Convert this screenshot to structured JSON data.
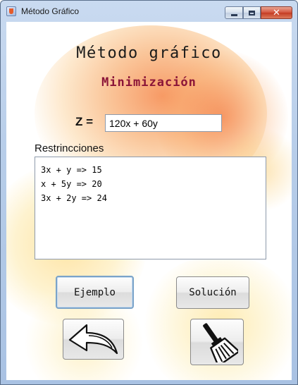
{
  "window": {
    "title": "Método Gráfico"
  },
  "main": {
    "heading": "Método gráfico",
    "subheading": "Minimización",
    "objective_label": "Z =",
    "objective_value": "120x + 60y",
    "constraints_label": "Restrincciones",
    "constraints": [
      "3x + y => 15",
      "x + 5y => 20",
      "3x + 2y => 24"
    ]
  },
  "buttons": {
    "example_label": "Ejemplo",
    "solution_label": "Solución",
    "back_icon": "back-arrow-icon",
    "clear_icon": "broom-icon"
  },
  "colors": {
    "subheading": "#8b1538",
    "splash_orange": "#f47832",
    "splash_yellow": "#fccd5a",
    "focus_border": "#7aa3c9"
  }
}
